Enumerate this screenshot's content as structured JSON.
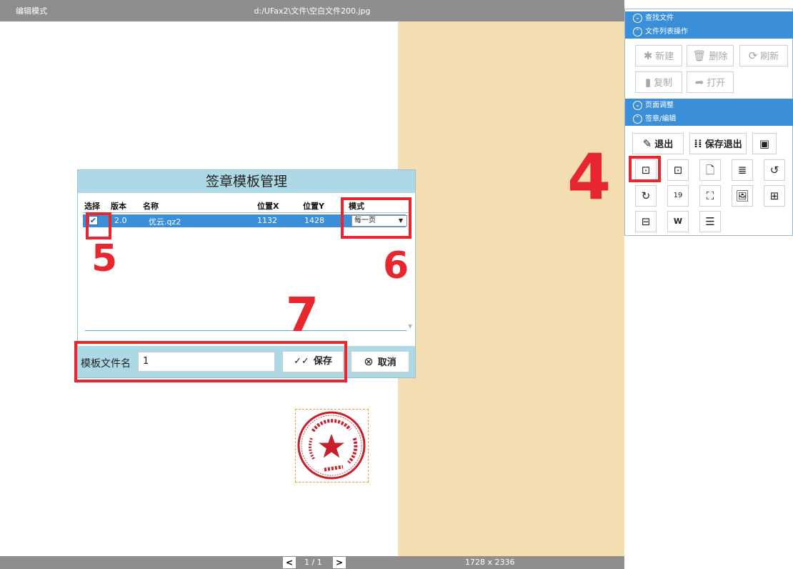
{
  "titlebar": {
    "mode": "编辑模式",
    "file_path": "d:/UFax2\\文件\\空白文件200.jpg"
  },
  "statusbar": {
    "prev": "<",
    "next": ">",
    "page": "1 / 1",
    "image_size": "1728 x 2336"
  },
  "panel": {
    "sections": {
      "find_file": "查找文件",
      "file_list_ops": "文件列表操作",
      "page_adjust": "页面调整",
      "sign_edit": "签章/编辑"
    },
    "file_buttons": {
      "new": "新建",
      "delete": "删除",
      "refresh": "刷新",
      "copy": "复制",
      "open": "打开"
    },
    "edit_buttons": {
      "exit": "退出",
      "save_exit": "保存退出"
    },
    "icons": {
      "chevron_down": "⌄",
      "chevron_up": "⌃",
      "new": "✱",
      "delete": "🗑",
      "refresh": "⟳",
      "copy": "▮",
      "open": "➦",
      "exit": "✎",
      "save_exit": "⁞⁞",
      "save": "▣",
      "stamp_add": "⊡",
      "stamp_star": "⊡",
      "page": "🗋",
      "multi": "≣",
      "rotate_ccw": "↺",
      "rotate_cw": "↻",
      "calendar": "19",
      "crop": "⛶",
      "image": "🖼",
      "plus": "⊞",
      "minus": "⊟",
      "word": "W",
      "menu": "☰"
    }
  },
  "dialog": {
    "title": "签章模板管理",
    "columns": [
      "选择",
      "版本",
      "名称",
      "位置X",
      "位置Y",
      "模式"
    ],
    "rows": [
      {
        "checked": "✔",
        "version": "2.0",
        "name": "优云.qz2",
        "x": "1132",
        "y": "1428",
        "mode": "每一页"
      }
    ],
    "filename_label": "模板文件名",
    "filename_value": "1",
    "save_label": "保存",
    "save_icon": "✓✓",
    "cancel_label": "取消",
    "cancel_icon": "⊗"
  },
  "annotations": {
    "n4": "4",
    "n5": "5",
    "n6": "6",
    "n7": "7",
    "color": "#e8262e"
  },
  "stamp": {
    "color": "#c8202a",
    "star": "★"
  }
}
